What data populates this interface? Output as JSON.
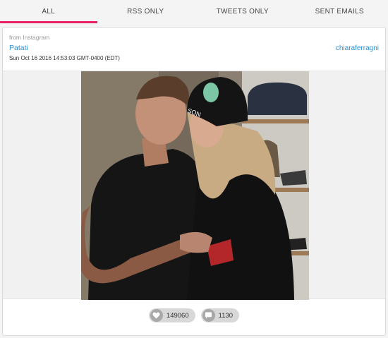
{
  "tabs": [
    {
      "label": "ALL",
      "active": true
    },
    {
      "label": "RSS ONLY",
      "active": false
    },
    {
      "label": "TWEETS ONLY",
      "active": false
    },
    {
      "label": "SENT EMAILS",
      "active": false
    }
  ],
  "post": {
    "source": "from Instagram",
    "author": "Patati",
    "date": "Sun Oct 16 2016  14:53:03 GMT-0400 (EDT)",
    "handle": "chiaraferragni",
    "hat_text": "SON",
    "likes": "149060",
    "comments": "1130"
  },
  "colors": {
    "accent": "#e91e63",
    "link": "#2d8fd6",
    "pill": "#d8d8d8"
  },
  "icons": {
    "likes": "heart-icon",
    "comments": "comment-bubble-icon"
  }
}
